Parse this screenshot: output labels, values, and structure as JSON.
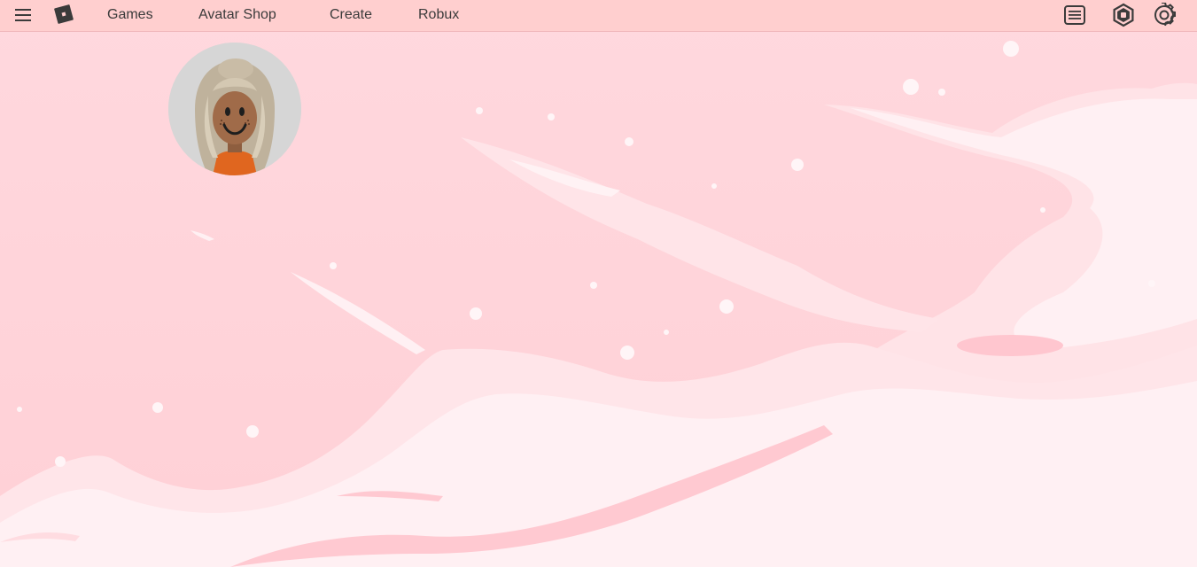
{
  "nav": {
    "links": [
      {
        "label": "Games"
      },
      {
        "label": "Avatar Shop"
      },
      {
        "label": "Create"
      },
      {
        "label": "Robux"
      }
    ]
  },
  "icons": {
    "menu": "hamburger-menu-icon",
    "logo": "roblox-logo-icon",
    "catalog": "list-icon",
    "robux": "robux-icon",
    "settings": "gear-icon"
  },
  "colors": {
    "topbar": "#ffcfcf",
    "background": "#ffd6dc",
    "cloud": "#fff0f2",
    "nav_text": "#3b3b3b"
  }
}
